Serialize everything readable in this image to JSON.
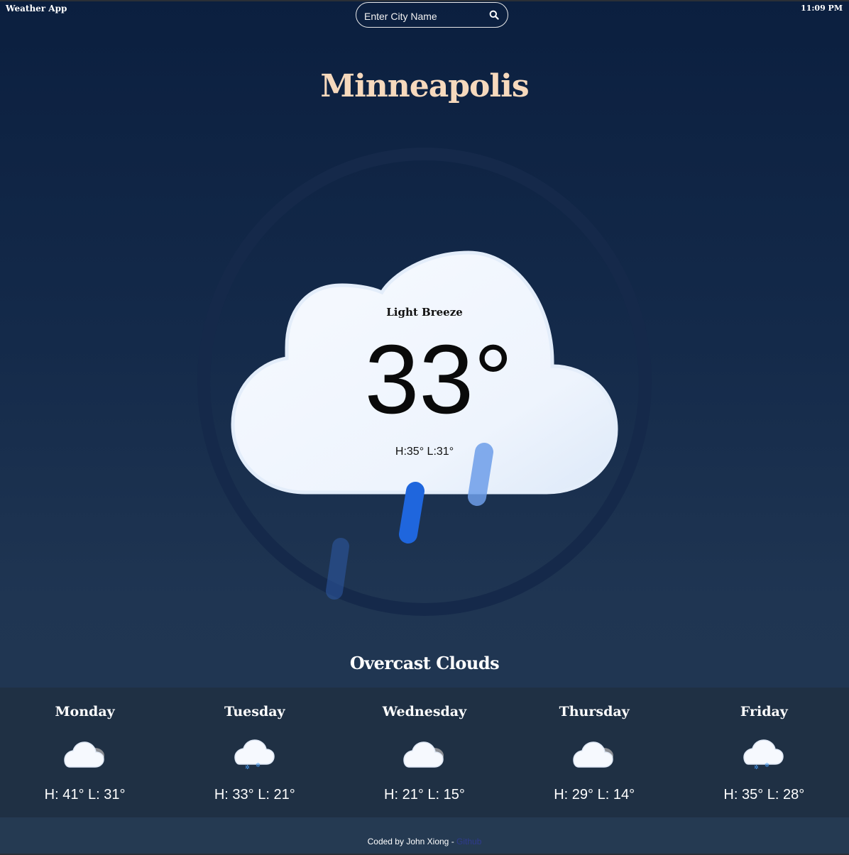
{
  "header": {
    "app_title": "Weather App",
    "time": "11:09 PM"
  },
  "search": {
    "placeholder": "Enter City Name",
    "value": "",
    "icon": "search-icon"
  },
  "current": {
    "city": "Minneapolis",
    "wind": "Light Breeze",
    "temperature": "33°",
    "hilo": "H:35° L:31°",
    "description": "Overcast Clouds",
    "icon": "cloud-rain-icon"
  },
  "forecast": [
    {
      "day": "Monday",
      "temps": "H: 41° L: 31°",
      "icon": "cloudy-icon"
    },
    {
      "day": "Tuesday",
      "temps": "H: 33° L: 21°",
      "icon": "snow-cloud-icon"
    },
    {
      "day": "Wednesday",
      "temps": "H: 21° L: 15°",
      "icon": "cloudy-icon"
    },
    {
      "day": "Thursday",
      "temps": "H: 29° L: 14°",
      "icon": "cloudy-icon"
    },
    {
      "day": "Friday",
      "temps": "H: 35° L: 28°",
      "icon": "snow-cloud-icon"
    }
  ],
  "footer": {
    "text": "Coded by John Xiong - ",
    "link": "Github"
  },
  "colors": {
    "city": "#f6d9bd",
    "background_top": "#0b1f3f",
    "background_bottom": "#223851",
    "forecast_bg": "#1f3044",
    "rain": "#2f74e0"
  }
}
